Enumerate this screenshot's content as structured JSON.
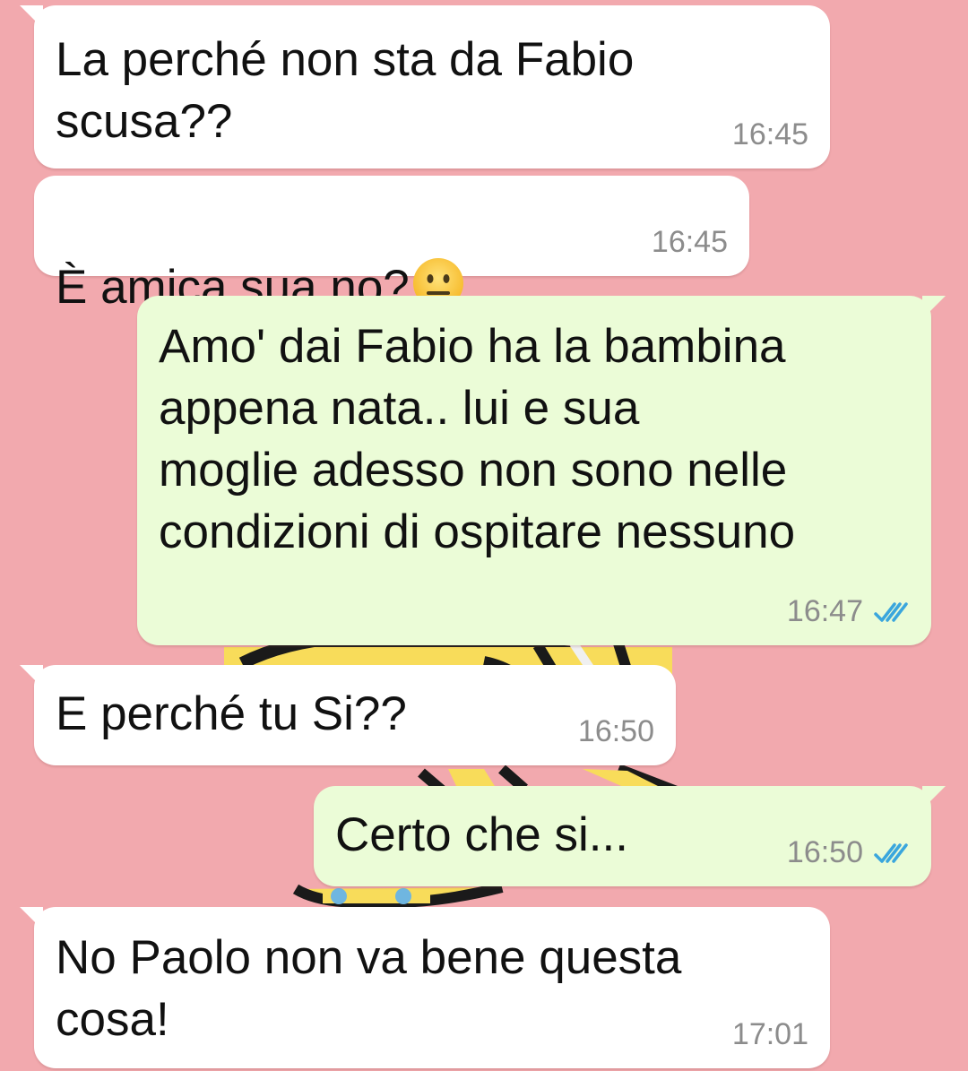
{
  "colors": {
    "wallpaper": "#f2a9ae",
    "incoming_bubble": "#ffffff",
    "outgoing_bubble": "#ebfcd7",
    "timestamp": "#8c8c8c",
    "read_ticks": "#3aa6dd"
  },
  "messages": [
    {
      "direction": "incoming",
      "text": "La perché non sta da Fabio\nscusa??",
      "time": "16:45"
    },
    {
      "direction": "incoming",
      "text": "È amica sua no?",
      "emoji": "neutral-face-icon",
      "time": "16:45"
    },
    {
      "direction": "outgoing",
      "text": "Amo' dai Fabio ha la bambina\nappena nata.. lui e sua\nmoglie adesso non sono nelle\ncondizioni di ospitare nessuno",
      "time": "16:47",
      "status": "read-double-check-icon"
    },
    {
      "direction": "incoming",
      "text": "E perché tu Si??",
      "time": "16:50"
    },
    {
      "direction": "outgoing",
      "text": "Certo che si...",
      "time": "16:50",
      "status": "read-double-check-icon"
    },
    {
      "direction": "incoming",
      "text": "No Paolo non va bene questa\ncosa!",
      "time": "17:01"
    }
  ]
}
